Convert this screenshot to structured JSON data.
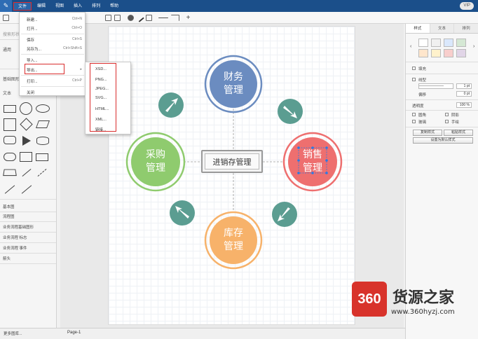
{
  "menubar": {
    "logo_glyph": "✎",
    "items": [
      "文件",
      "编辑",
      "视图",
      "插入",
      "排列",
      "帮助"
    ],
    "vip": "VIP"
  },
  "sidebar": {
    "search_placeholder": "搜索形状",
    "general_header": "通用",
    "basic_header": "基础图形",
    "text_label": "文本",
    "categories": [
      "基本图",
      "流程图",
      "业务流程基础图形",
      "业务流程 标志",
      "业务流程 事件",
      "箭头"
    ],
    "more_shapes": "更多图库..."
  },
  "file_menu": {
    "items": [
      {
        "label": "新建...",
        "shortcut": "Ctrl+N"
      },
      {
        "label": "打开...",
        "shortcut": "Ctrl+O"
      },
      {
        "label": "保存",
        "shortcut": "Ctrl+S"
      },
      {
        "label": "另存为...",
        "shortcut": "Ctrl+Shift+S"
      },
      {
        "label": "导入..."
      },
      {
        "label": "导出..."
      },
      {
        "label": "打印...",
        "shortcut": "Ctrl+P"
      },
      {
        "label": "关闭"
      }
    ]
  },
  "export_menu": {
    "items": [
      "XSD...",
      "PNG...",
      "JPEG...",
      "SVG...",
      "HTML...",
      "XML...",
      "链接..."
    ]
  },
  "diagram": {
    "center": "进销存管理",
    "finance": [
      "财务",
      "管理"
    ],
    "purchase": [
      "采购",
      "管理"
    ],
    "sales": [
      "销售",
      "管理"
    ],
    "inventory": [
      "库存",
      "管理"
    ],
    "colors": {
      "finance": "#6b8cc0",
      "purchase": "#8fcb6e",
      "sales": "#ee6f6f",
      "inventory": "#f7b26a",
      "arrows": "#5b9d91"
    }
  },
  "right_panel": {
    "tabs": [
      "样式",
      "文本",
      "排列"
    ],
    "swatch_colors": [
      "#ffffff",
      "#f0f0f0",
      "#dae8fc",
      "#d5e8d4",
      "#ffe6cc",
      "#fff2cc",
      "#f8cecc",
      "#e1d5e7"
    ],
    "fill_label": "填充",
    "line_label": "线型",
    "line_width": "1 pt",
    "offset_label": "偏移",
    "offset_value": "0 pt",
    "opacity_label": "透明度",
    "opacity_value": "100 %",
    "rounded_label": "圆角",
    "shadow_label": "阴影",
    "glass_label": "玻璃",
    "sketch_label": "手绘",
    "copy_style": "复制样式",
    "paste_style": "粘贴样式",
    "set_default": "设置为默认样式"
  },
  "bottom": {
    "page_tab": "Page-1"
  },
  "watermark": {
    "badge": "360",
    "brand": "货源之家",
    "url": "www.360hyzj.com"
  }
}
